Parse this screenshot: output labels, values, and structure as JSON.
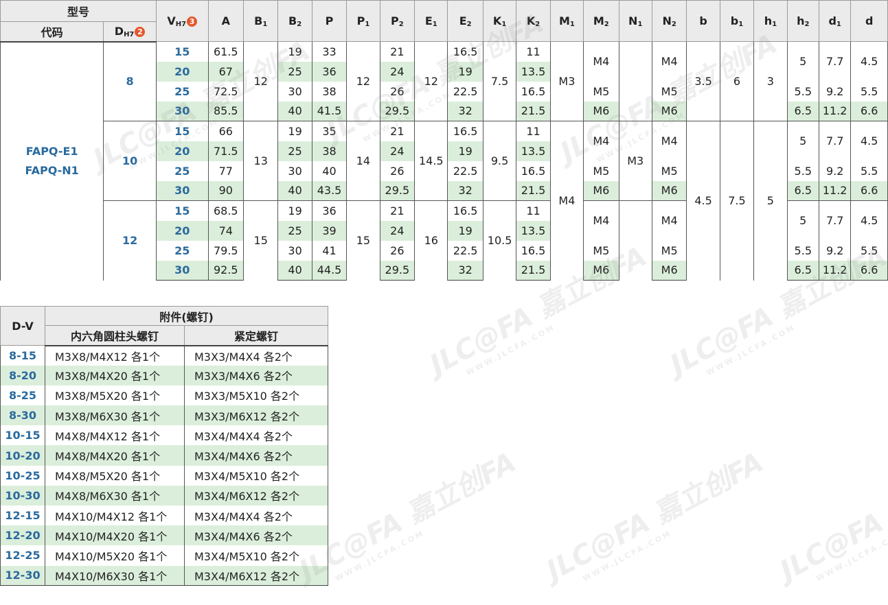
{
  "spec_table": {
    "header": {
      "model": "型号",
      "code": "代码",
      "d": "D",
      "d_sub": "H7",
      "d_badge": "2",
      "v": "V",
      "v_sub": "H7",
      "v_badge": "3",
      "cols": [
        {
          "b": "A",
          "s": ""
        },
        {
          "b": "B",
          "s": "1"
        },
        {
          "b": "B",
          "s": "2"
        },
        {
          "b": "P",
          "s": ""
        },
        {
          "b": "P",
          "s": "1"
        },
        {
          "b": "P",
          "s": "2"
        },
        {
          "b": "E",
          "s": "1"
        },
        {
          "b": "E",
          "s": "2"
        },
        {
          "b": "K",
          "s": "1"
        },
        {
          "b": "K",
          "s": "2"
        },
        {
          "b": "M",
          "s": "1"
        },
        {
          "b": "M",
          "s": "2"
        },
        {
          "b": "N",
          "s": "1"
        },
        {
          "b": "N",
          "s": "2"
        },
        {
          "b": "b",
          "s": ""
        },
        {
          "b": "b",
          "s": "1"
        },
        {
          "b": "h",
          "s": "1"
        },
        {
          "b": "h",
          "s": "2"
        },
        {
          "b": "d",
          "s": "1"
        },
        {
          "b": "d",
          "s": ""
        }
      ]
    },
    "code_line1": "FAPQ-E1",
    "code_line2": "FAPQ-N1",
    "groups": [
      {
        "d": "8",
        "B1": "12",
        "P1": "12",
        "E1": "12",
        "K1": "7.5",
        "rows": [
          {
            "V": "15",
            "A": "61.5",
            "B2": "19",
            "P": "33",
            "P2": "21",
            "E2": "16.5",
            "K2": "11"
          },
          {
            "V": "20",
            "A": "67",
            "B2": "25",
            "P": "36",
            "P2": "24",
            "E2": "19",
            "K2": "13.5"
          },
          {
            "V": "25",
            "A": "72.5",
            "B2": "30",
            "P": "38",
            "P2": "26",
            "E2": "22.5",
            "K2": "16.5"
          },
          {
            "V": "30",
            "A": "85.5",
            "B2": "40",
            "P": "41.5",
            "P2": "29.5",
            "E2": "32",
            "K2": "21.5"
          }
        ]
      },
      {
        "d": "10",
        "B1": "13",
        "P1": "14",
        "E1": "14.5",
        "K1": "9.5",
        "rows": [
          {
            "V": "15",
            "A": "66",
            "B2": "19",
            "P": "35",
            "P2": "21",
            "E2": "16.5",
            "K2": "11"
          },
          {
            "V": "20",
            "A": "71.5",
            "B2": "25",
            "P": "38",
            "P2": "24",
            "E2": "19",
            "K2": "13.5"
          },
          {
            "V": "25",
            "A": "77",
            "B2": "30",
            "P": "40",
            "P2": "26",
            "E2": "22.5",
            "K2": "16.5"
          },
          {
            "V": "30",
            "A": "90",
            "B2": "40",
            "P": "43.5",
            "P2": "29.5",
            "E2": "32",
            "K2": "21.5"
          }
        ]
      },
      {
        "d": "12",
        "B1": "15",
        "P1": "15",
        "E1": "16",
        "K1": "10.5",
        "rows": [
          {
            "V": "15",
            "A": "68.5",
            "B2": "19",
            "P": "36",
            "P2": "21",
            "E2": "16.5",
            "K2": "11"
          },
          {
            "V": "20",
            "A": "74",
            "B2": "25",
            "P": "39",
            "P2": "24",
            "E2": "19",
            "K2": "13.5"
          },
          {
            "V": "25",
            "A": "79.5",
            "B2": "30",
            "P": "41",
            "P2": "26",
            "E2": "22.5",
            "K2": "16.5"
          },
          {
            "V": "30",
            "A": "92.5",
            "B2": "40",
            "P": "44.5",
            "P2": "29.5",
            "E2": "32",
            "K2": "21.5"
          }
        ]
      }
    ],
    "m1": {
      "top": "M3",
      "bottom": "M4"
    },
    "n1": "M3",
    "m2": {
      "small": "M4",
      "mid": "M5",
      "large": "M6"
    },
    "n2": {
      "small": "M4",
      "mid": "M5",
      "large": "M6"
    },
    "b": {
      "top": "3.5",
      "bottom": "4.5"
    },
    "b1": {
      "top": "6",
      "bottom": "7.5"
    },
    "h1": {
      "top": "3",
      "bottom": "5"
    },
    "h2": {
      "small": "5",
      "mid": "5.5",
      "large": "6.5"
    },
    "d1": {
      "small": "7.7",
      "mid": "9.2",
      "large": "11.2"
    },
    "dd": {
      "small": "4.5",
      "mid": "5.5",
      "large": "6.6"
    }
  },
  "accessory_table": {
    "header": {
      "dv": "D-V",
      "group": "附件(螺钉)",
      "col1": "内六角圆柱头螺钉",
      "col2": "紧定螺钉"
    },
    "rows": [
      {
        "dv": "8-15",
        "screw": "M3X8/M4X12  各1个",
        "set": "M3X3/M4X4  各2个"
      },
      {
        "dv": "8-20",
        "screw": "M3X8/M4X20  各1个",
        "set": "M3X3/M4X6  各2个"
      },
      {
        "dv": "8-25",
        "screw": "M3X8/M5X20  各1个",
        "set": "M3X3/M5X10  各2个"
      },
      {
        "dv": "8-30",
        "screw": "M3X8/M6X30  各1个",
        "set": "M3X3/M6X12  各2个"
      },
      {
        "dv": "10-15",
        "screw": "M4X8/M4X12  各1个",
        "set": "M3X4/M4X4  各2个"
      },
      {
        "dv": "10-20",
        "screw": "M4X8/M4X20  各1个",
        "set": "M3X4/M4X6  各2个"
      },
      {
        "dv": "10-25",
        "screw": "M4X8/M5X20  各1个",
        "set": "M3X4/M5X10  各2个"
      },
      {
        "dv": "10-30",
        "screw": "M4X8/M6X30  各1个",
        "set": "M3X4/M6X12  各2个"
      },
      {
        "dv": "12-15",
        "screw": "M4X10/M4X12  各1个",
        "set": "M3X4/M4X4  各2个"
      },
      {
        "dv": "12-20",
        "screw": "M4X10/M4X20  各1个",
        "set": "M3X4/M4X6  各2个"
      },
      {
        "dv": "12-25",
        "screw": "M4X10/M5X20  各1个",
        "set": "M3X4/M5X10  各2个"
      },
      {
        "dv": "12-30",
        "screw": "M4X10/M6X30  各1个",
        "set": "M3X4/M6X12  各2个"
      }
    ]
  },
  "watermark": {
    "logo": "JLC@FA 嘉立创FA",
    "url": "WWW.JLCFA.COM"
  },
  "colors": {
    "stripe": "#dbeedb",
    "header_bg": "#ebebeb",
    "accent_text": "#2a6a9e",
    "badge": "#e4572e"
  }
}
